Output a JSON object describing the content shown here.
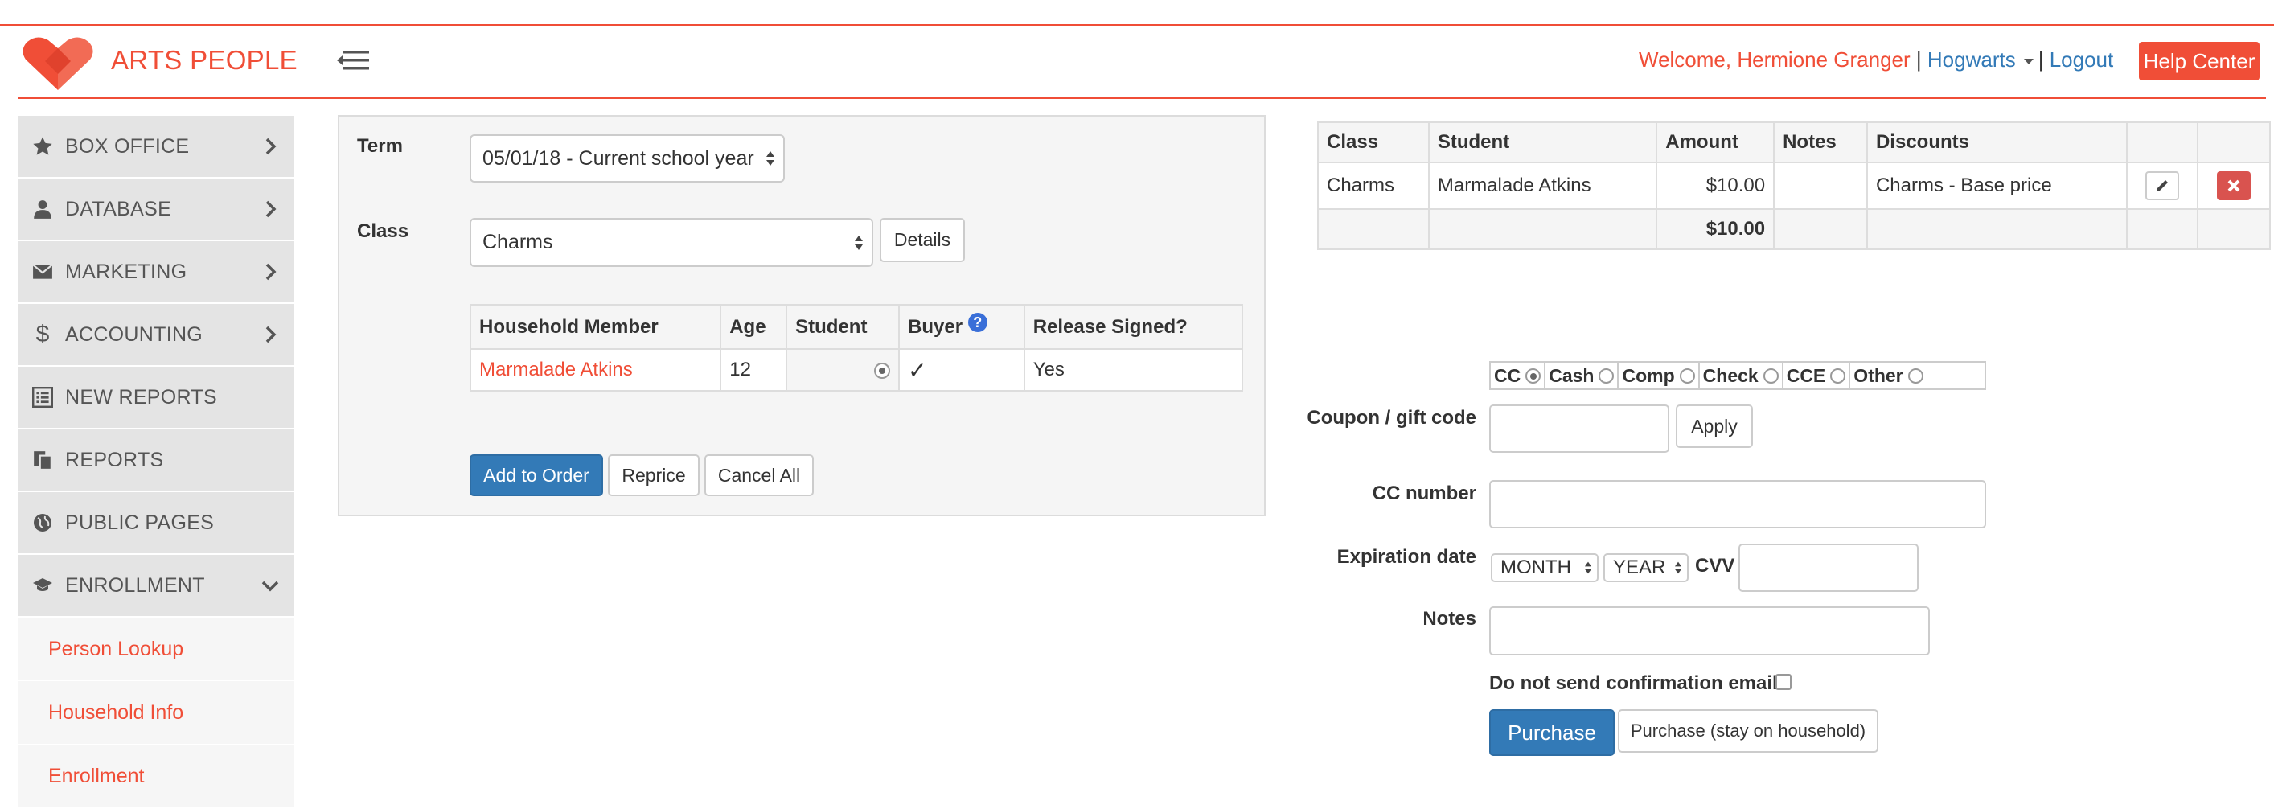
{
  "brand": {
    "name": "ARTS PEOPLE"
  },
  "header": {
    "welcome": "Welcome, Hermione Granger",
    "separator": "|",
    "org": "Hogwarts",
    "logout": "Logout",
    "help": "Help Center"
  },
  "sidebar": {
    "items": [
      {
        "label": "BOX OFFICE",
        "icon": "star-icon"
      },
      {
        "label": "DATABASE",
        "icon": "user-icon"
      },
      {
        "label": "MARKETING",
        "icon": "envelope-icon"
      },
      {
        "label": "ACCOUNTING",
        "icon": "dollar-icon"
      },
      {
        "label": "NEW REPORTS",
        "icon": "list-icon"
      },
      {
        "label": "REPORTS",
        "icon": "documents-icon"
      },
      {
        "label": "PUBLIC PAGES",
        "icon": "globe-icon"
      },
      {
        "label": "ENROLLMENT",
        "icon": "graduation-cap-icon"
      }
    ],
    "sub_items": [
      "Person Lookup",
      "Household Info",
      "Enrollment"
    ]
  },
  "form": {
    "term_label": "Term",
    "term_value": "05/01/18 - Current school year",
    "class_label": "Class",
    "class_value": "Charms",
    "details_button": "Details",
    "household_table": {
      "headers": [
        "Household Member",
        "Age",
        "Student",
        "Buyer",
        "Release Signed?"
      ],
      "rows": [
        {
          "member": "Marmalade Atkins",
          "age": "12",
          "release": "Yes"
        }
      ]
    },
    "checkmark": "✓",
    "buyer_help": "?",
    "add_to_order": "Add to Order",
    "reprice": "Reprice",
    "cancel_all": "Cancel All"
  },
  "order_table": {
    "headers": [
      "Class",
      "Student",
      "Amount",
      "Notes",
      "Discounts"
    ],
    "rows": [
      {
        "class": "Charms",
        "student": "Marmalade Atkins",
        "amount": "$10.00",
        "notes": "",
        "discounts": "Charms - Base price"
      }
    ],
    "total": "$10.00"
  },
  "payment": {
    "methods": [
      "CC",
      "Cash",
      "Comp",
      "Check",
      "CCE",
      "Other"
    ],
    "selected_method": "CC",
    "coupon_label": "Coupon / gift code",
    "apply": "Apply",
    "cc_label": "CC number",
    "exp_label": "Expiration date",
    "month": "MONTH",
    "year": "YEAR",
    "cvv_label": "CVV",
    "notes_label": "Notes",
    "no_email_label": "Do not send confirmation email",
    "purchase": "Purchase",
    "purchase_stay": "Purchase (stay on household)"
  },
  "colors": {
    "brand": "#f04e37",
    "primary": "#337ab7",
    "danger": "#d9534f"
  }
}
